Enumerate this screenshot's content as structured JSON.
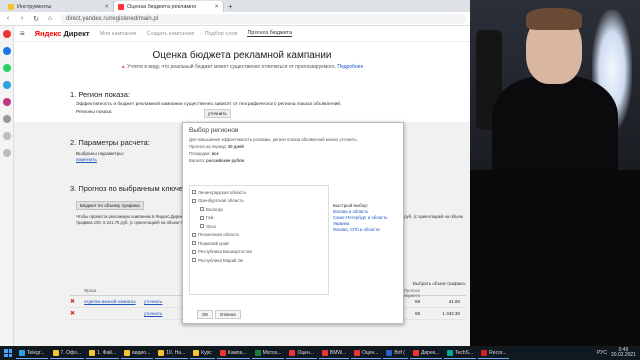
{
  "browser": {
    "tabs": [
      {
        "label": "Инструменты",
        "active": false
      },
      {
        "label": "Оценка бюджета рекламно",
        "active": true
      }
    ],
    "url": "direct.yandex.ru/registered/main.pl"
  },
  "header": {
    "logo_ya": "Яндекс",
    "logo_product": "Директ",
    "nav": [
      "Мои кампании",
      "Создать кампанию",
      "Подбор слов",
      "Прогноз бюджета"
    ]
  },
  "main": {
    "title": "Оценка бюджета рекламной кампании",
    "note": "Учтите в виду, что реальный бюджет может существенно отличаться от прогнозируемого.",
    "note_link": "Подробнее",
    "sec1_title": "1. Регион показа:",
    "sec1_text": "Эффективность и бюджет рекламной кампании существенно зависят от географического региона показа объявлений.",
    "sec1_label": "Регионы показа:",
    "sec1_btn": "уточнить",
    "sec2_title": "2. Параметры расчета:",
    "sec2_label": "Выбраны параметры:",
    "sec2_link": "изменить",
    "sec3_title": "3. Прогноз по выбранным ключевым фразам",
    "sec3_btn": "Бюджет по объему трафика",
    "forecast_line": "Чтобы провести рекламную кампанию в Яндекс.Директе по выбранным ключевым фразам на указанный в параметрах расчета период потребуется примерно 9 753.60 руб. (с ориентацией на объем трафика 100, 6 241.70 руб. (с ориентацией на объем трафика 75), 5 308.30 руб. (с ориентацией на объем трафика 65)."
  },
  "dialog": {
    "title": "Выбор регионов",
    "text": "Для повышения эффективности рекламы, регион показа объявлений можно уточнить.",
    "period_label": "Прогноз на период:",
    "period_value": "30 дней",
    "region_label": "Площадки:",
    "region_value": "все",
    "currency_label": "Валюта:",
    "currency_value": "российские рубли",
    "tree": [
      "Ленинградская область",
      "Оренбургская область",
      "Вологда",
      "Гай",
      "Орск",
      "Пензенская область",
      "Пермский край",
      "Республика Башкортостан",
      "Республика Марий Эл"
    ],
    "quick_title": "Быстрый выбор:",
    "quick": [
      "Москва и область",
      "Санкт-Петербург и область",
      "Украина",
      "Москва, СПб и области"
    ],
    "btn_ok": "ОК",
    "btn_cancel": "Отмена"
  },
  "table": {
    "headers": [
      "",
      "Фраза",
      "",
      "Прогноз переходов",
      "Объем трафика",
      "Списываемая цена",
      "Прогноз CTR",
      "Прогноз кликов",
      "Прогноз бюджета"
    ],
    "right_header": "Выбрать объем трафика:",
    "rows": [
      {
        "phrase": "отделка ванной комнаты",
        "action": "уточнить",
        "v1": "132",
        "v2": "100",
        "v3": "56.50",
        "v4": "10.40",
        "v5": "5.00",
        "v6": "69",
        "v7": "41.60"
      },
      {
        "phrase": "",
        "action": "уточнить",
        "v1": "",
        "v2": "",
        "v3": "30.50",
        "v4": "10.30",
        "v5": "5.00",
        "v6": "68",
        "v7": "1 342.30"
      }
    ]
  },
  "taskbar": {
    "items": [
      "Telegr...",
      "7. Офо...",
      "1. Фай...",
      "видео...",
      "10. На...",
      "Курс",
      "Кампа...",
      "Micros...",
      "Оцен...",
      "BMW...",
      "Оцен...",
      "Brif (",
      "Дирек...",
      "TechS...",
      "Recor..."
    ],
    "lang": "РУС",
    "time": "0:49",
    "date": "20.02.2021"
  }
}
